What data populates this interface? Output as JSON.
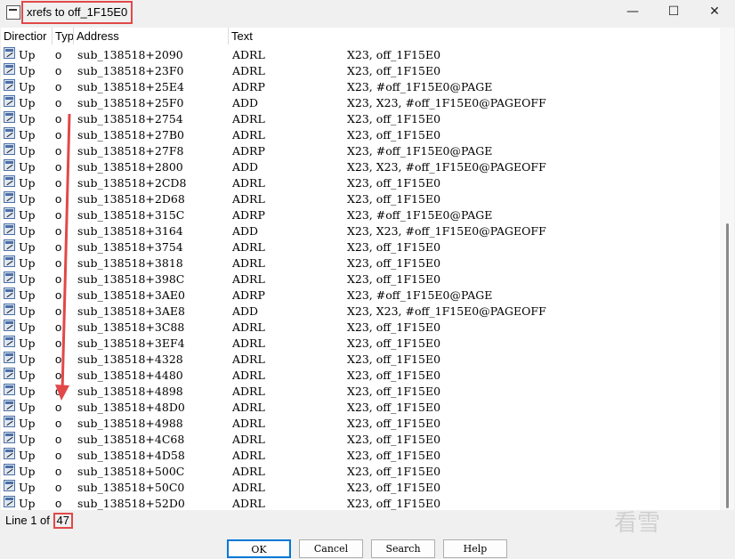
{
  "window": {
    "title": "xrefs to off_1F15E0",
    "minimize": "—",
    "maximize": "☐",
    "close": "✕"
  },
  "columns": [
    "Directior",
    "Typ",
    "Address",
    "Text"
  ],
  "rows": [
    {
      "dir": "Up",
      "type": "o",
      "address": "sub_138518+2090",
      "mnemonic": "ADRL",
      "operands": "X23, off_1F15E0"
    },
    {
      "dir": "Up",
      "type": "o",
      "address": "sub_138518+23F0",
      "mnemonic": "ADRL",
      "operands": "X23, off_1F15E0"
    },
    {
      "dir": "Up",
      "type": "o",
      "address": "sub_138518+25E4",
      "mnemonic": "ADRP",
      "operands": "X23, #off_1F15E0@PAGE"
    },
    {
      "dir": "Up",
      "type": "o",
      "address": "sub_138518+25F0",
      "mnemonic": "ADD",
      "operands": "X23, X23, #off_1F15E0@PAGEOFF"
    },
    {
      "dir": "Up",
      "type": "o",
      "address": "sub_138518+2754",
      "mnemonic": "ADRL",
      "operands": "X23, off_1F15E0"
    },
    {
      "dir": "Up",
      "type": "o",
      "address": "sub_138518+27B0",
      "mnemonic": "ADRL",
      "operands": "X23, off_1F15E0"
    },
    {
      "dir": "Up",
      "type": "o",
      "address": "sub_138518+27F8",
      "mnemonic": "ADRP",
      "operands": "X23, #off_1F15E0@PAGE"
    },
    {
      "dir": "Up",
      "type": "o",
      "address": "sub_138518+2800",
      "mnemonic": "ADD",
      "operands": "X23, X23, #off_1F15E0@PAGEOFF"
    },
    {
      "dir": "Up",
      "type": "o",
      "address": "sub_138518+2CD8",
      "mnemonic": "ADRL",
      "operands": "X23, off_1F15E0"
    },
    {
      "dir": "Up",
      "type": "o",
      "address": "sub_138518+2D68",
      "mnemonic": "ADRL",
      "operands": "X23, off_1F15E0"
    },
    {
      "dir": "Up",
      "type": "o",
      "address": "sub_138518+315C",
      "mnemonic": "ADRP",
      "operands": "X23, #off_1F15E0@PAGE"
    },
    {
      "dir": "Up",
      "type": "o",
      "address": "sub_138518+3164",
      "mnemonic": "ADD",
      "operands": "X23, X23, #off_1F15E0@PAGEOFF"
    },
    {
      "dir": "Up",
      "type": "o",
      "address": "sub_138518+3754",
      "mnemonic": "ADRL",
      "operands": "X23, off_1F15E0"
    },
    {
      "dir": "Up",
      "type": "o",
      "address": "sub_138518+3818",
      "mnemonic": "ADRL",
      "operands": "X23, off_1F15E0"
    },
    {
      "dir": "Up",
      "type": "o",
      "address": "sub_138518+398C",
      "mnemonic": "ADRL",
      "operands": "X23, off_1F15E0"
    },
    {
      "dir": "Up",
      "type": "o",
      "address": "sub_138518+3AE0",
      "mnemonic": "ADRP",
      "operands": "X23, #off_1F15E0@PAGE"
    },
    {
      "dir": "Up",
      "type": "o",
      "address": "sub_138518+3AE8",
      "mnemonic": "ADD",
      "operands": "X23, X23, #off_1F15E0@PAGEOFF"
    },
    {
      "dir": "Up",
      "type": "o",
      "address": "sub_138518+3C88",
      "mnemonic": "ADRL",
      "operands": "X23, off_1F15E0"
    },
    {
      "dir": "Up",
      "type": "o",
      "address": "sub_138518+3EF4",
      "mnemonic": "ADRL",
      "operands": "X23, off_1F15E0"
    },
    {
      "dir": "Up",
      "type": "o",
      "address": "sub_138518+4328",
      "mnemonic": "ADRL",
      "operands": "X23, off_1F15E0"
    },
    {
      "dir": "Up",
      "type": "o",
      "address": "sub_138518+4480",
      "mnemonic": "ADRL",
      "operands": "X23, off_1F15E0"
    },
    {
      "dir": "Up",
      "type": "o",
      "address": "sub_138518+4898",
      "mnemonic": "ADRL",
      "operands": "X23, off_1F15E0"
    },
    {
      "dir": "Up",
      "type": "o",
      "address": "sub_138518+48D0",
      "mnemonic": "ADRL",
      "operands": "X23, off_1F15E0"
    },
    {
      "dir": "Up",
      "type": "o",
      "address": "sub_138518+4988",
      "mnemonic": "ADRL",
      "operands": "X23, off_1F15E0"
    },
    {
      "dir": "Up",
      "type": "o",
      "address": "sub_138518+4C68",
      "mnemonic": "ADRL",
      "operands": "X23, off_1F15E0"
    },
    {
      "dir": "Up",
      "type": "o",
      "address": "sub_138518+4D58",
      "mnemonic": "ADRL",
      "operands": "X23, off_1F15E0"
    },
    {
      "dir": "Up",
      "type": "o",
      "address": "sub_138518+500C",
      "mnemonic": "ADRL",
      "operands": "X23, off_1F15E0"
    },
    {
      "dir": "Up",
      "type": "o",
      "address": "sub_138518+50C0",
      "mnemonic": "ADRL",
      "operands": "X23, off_1F15E0"
    },
    {
      "dir": "Up",
      "type": "o",
      "address": "sub_138518+52D0",
      "mnemonic": "ADRL",
      "operands": "X23, off_1F15E0"
    }
  ],
  "status": {
    "prefix": "Line 1 of",
    "count": "47"
  },
  "buttons": {
    "ok": "OK",
    "cancel": "Cancel",
    "search": "Search",
    "help": "Help"
  },
  "watermark": "看雪",
  "colors": {
    "highlight": "#e24848",
    "focus": "#0078d7"
  }
}
